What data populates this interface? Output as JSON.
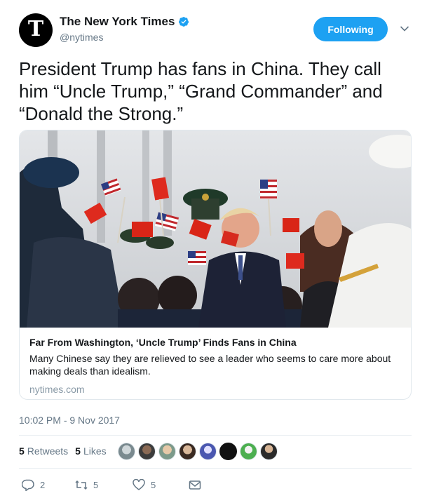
{
  "account": {
    "display_name": "The New York Times",
    "handle": "@nytimes",
    "avatar_glyph": "T",
    "verified": true
  },
  "follow_button": {
    "label": "Following",
    "color": "#1da1f2"
  },
  "tweet": {
    "text": "President Trump has fans in China. They call him “Uncle Trump,” “Grand Commander” and “Donald the Strong.”"
  },
  "card": {
    "title": "Far From Washington, ‘Uncle Trump’ Finds Fans in China",
    "description": "Many Chinese say they are relieved to see a leader who seems to care more about making deals than idealism.",
    "domain": "nytimes.com"
  },
  "timestamp": "10:02 PM - 9 Nov 2017",
  "stats": {
    "retweets_count": "5",
    "retweets_label": "Retweets",
    "likes_count": "5",
    "likes_label": "Likes"
  },
  "actions": {
    "replies": "2",
    "retweets": "5",
    "likes": "5"
  },
  "colors": {
    "text": "#14171a",
    "secondary": "#657786",
    "border": "#e1e8ed",
    "accent": "#1da1f2"
  }
}
